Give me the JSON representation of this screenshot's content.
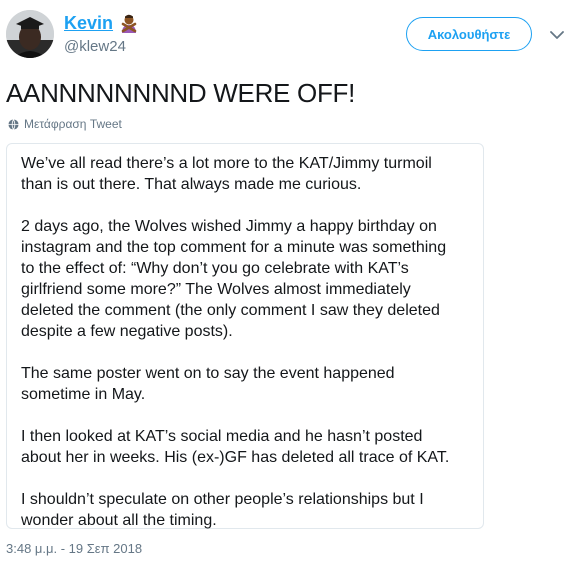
{
  "user": {
    "name": "Kevin",
    "handle": "@klew24"
  },
  "follow_button": "Ακολουθήστε",
  "tweet": {
    "text": "AANNNNNNNND WERE OFF!",
    "translate_label": "Μετάφραση Tweet",
    "timestamp": "3:48 μ.μ. - 19 Σεπ 2018"
  },
  "screenshot": {
    "paragraphs": [
      [
        "We’ve all read there’s a lot more to the KAT/Jimmy turmoil",
        "than is out there. That always made me curious."
      ],
      [
        "2 days ago, the Wolves wished Jimmy a happy birthday on",
        "instagram and the top comment for a minute was something",
        "to the effect of: “Why don’t you go celebrate with KAT’s",
        "girlfriend some more?” The Wolves almost immediately",
        "deleted the comment (the only comment I saw they deleted",
        "despite a few negative posts)."
      ],
      [
        "The same poster went on to say the event happened",
        "sometime in May."
      ],
      [
        "I then looked at KAT’s social media and he hasn’t posted",
        "about her in weeks. His (ex-)GF has deleted all trace of KAT."
      ],
      [
        "I shouldn’t speculate on other people’s relationships but I",
        "wonder about all the timing."
      ]
    ]
  },
  "icons": {
    "avatar": "avatar-photo",
    "name_emoji": "person-gesturing-no-emoji",
    "caret": "chevron-down-icon",
    "translate": "globe-icon"
  },
  "colors": {
    "accent": "#1da1f2",
    "text": "#14171a",
    "muted": "#657786",
    "border": "#e1e8ed"
  }
}
